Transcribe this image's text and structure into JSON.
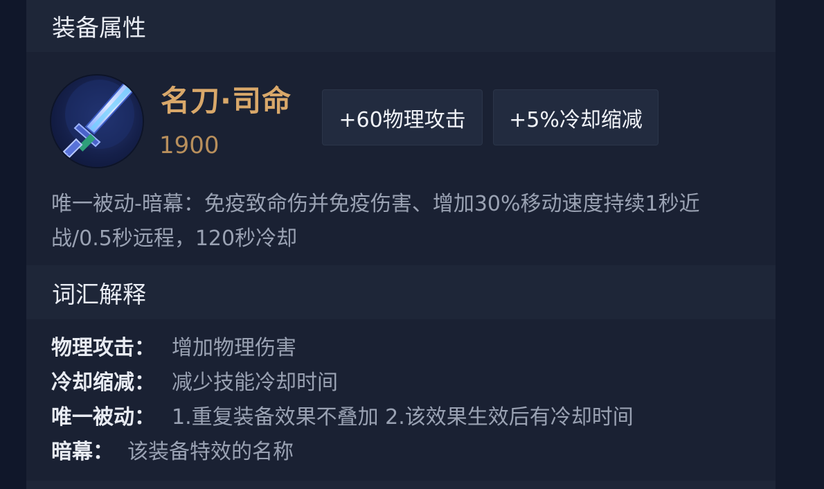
{
  "sections": {
    "attributes_title": "装备属性",
    "glossary_title": "词汇解释"
  },
  "item": {
    "icon": "sword-icon",
    "name": "名刀·司命",
    "price": "1900",
    "stats": [
      "+60物理攻击",
      "+5%冷却缩减"
    ],
    "passive_line1": "唯一被动-暗幕：免疫致命伤并免疫伤害、增加30%移动速度持续1秒近",
    "passive_line2": "战/0.5秒远程，120秒冷却"
  },
  "glossary": [
    {
      "term": "物理攻击：",
      "definition": "增加物理伤害"
    },
    {
      "term": "冷却缩减：",
      "definition": "减少技能冷却时间"
    },
    {
      "term": "唯一被动：",
      "definition": "1.重复装备效果不叠加 2.该效果生效后有冷却时间"
    },
    {
      "term": "暗幕：",
      "definition": "该装备特效的名称"
    }
  ],
  "colors": {
    "item_name": "#d9a86a",
    "price": "#b88f5c",
    "background": "#1a2133"
  }
}
